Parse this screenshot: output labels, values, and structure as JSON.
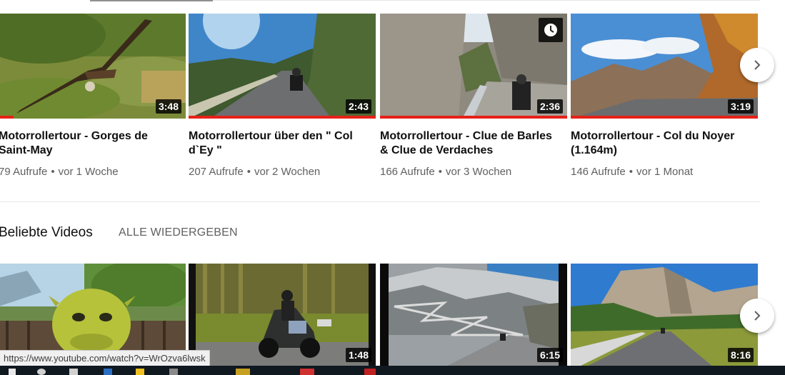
{
  "row1": [
    {
      "title": "Motorrollertour - Gorges de Saint-May",
      "views": "79 Aufrufe",
      "age": "vor 1 Woche",
      "duration": "3:48",
      "watch_progress": 0.08
    },
    {
      "title": "Motorrollertour über den \" Col d`Ey \"",
      "views": "207 Aufrufe",
      "age": "vor 2 Wochen",
      "duration": "2:43",
      "watch_progress": 1.0
    },
    {
      "title": "Motorrollertour - Clue de Barles & Clue de Verdaches",
      "views": "166 Aufrufe",
      "age": "vor 3 Wochen",
      "duration": "2:36",
      "watch_progress": 1.0
    },
    {
      "title": "Motorrollertour - Col du Noyer (1.164m)",
      "views": "146 Aufrufe",
      "age": "vor 1 Monat",
      "duration": "3:19",
      "watch_progress": 1.0
    }
  ],
  "meta_separator": "•",
  "section": {
    "title": "Beliebte Videos",
    "play_all": "ALLE WIEDERGEBEN"
  },
  "row2": [
    {
      "duration": ""
    },
    {
      "duration": "1:48"
    },
    {
      "duration": "6:15"
    },
    {
      "duration": "8:16"
    }
  ],
  "status_bar": {
    "url": "https://www.youtube.com/watch?v=WrOzva6lwsk"
  },
  "icons": {
    "next": "chevron-right-icon",
    "watch_later": "clock-icon"
  },
  "colors": {
    "progress": "#e62117",
    "meta_text": "#606060",
    "title_text": "#0f0f0f"
  }
}
